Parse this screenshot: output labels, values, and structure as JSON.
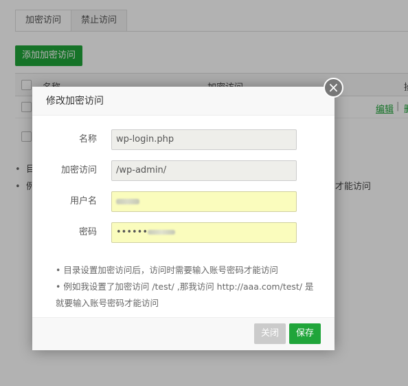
{
  "tabs": [
    {
      "label": "加密访问"
    },
    {
      "label": "禁止访问"
    }
  ],
  "toolbar": {
    "add_label": "添加加密访问"
  },
  "table": {
    "headers": {
      "name": "名称",
      "access": "加密访问",
      "op": "操"
    },
    "row": {
      "edit": "编辑",
      "sep": "|",
      "del": "删"
    }
  },
  "page_tips": [
    {
      "text": "目"
    },
    {
      "text": "例",
      "tail": "才能访问"
    }
  ],
  "modal": {
    "title": "修改加密访问",
    "close_glyph": "×",
    "fields": {
      "name": {
        "label": "名称",
        "value": "wp-login.php"
      },
      "access": {
        "label": "加密访问",
        "value": "/wp-admin/"
      },
      "username": {
        "label": "用户名",
        "value": ""
      },
      "password": {
        "label": "密码",
        "value": "••••••"
      }
    },
    "tips": [
      "•  目录设置加密访问后，访问时需要输入账号密码才能访问",
      "•  例如我设置了加密访问 /test/ ,那我访问 http://aaa.com/test/ 是",
      "就要输入账号密码才能访问"
    ],
    "buttons": {
      "close": "关闭",
      "save": "保存"
    }
  },
  "colors": {
    "accent": "#20a53a",
    "overlay": "rgba(0,0,0,0.3)",
    "input_yellow": "#fafcbd"
  }
}
